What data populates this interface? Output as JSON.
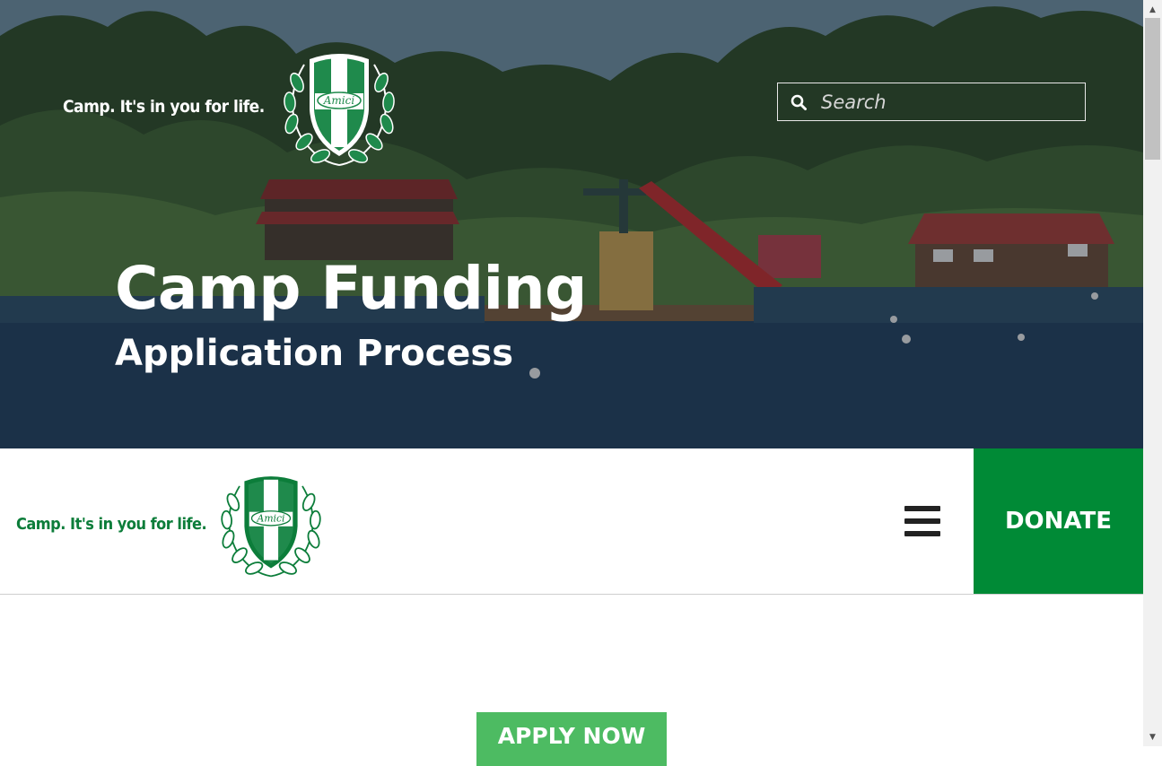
{
  "brand": {
    "tagline": "Camp. It's in you for life.",
    "crest_text": "Amici",
    "color_green": "#008a36",
    "color_green_light": "#4dbb62"
  },
  "hero": {
    "title": "Camp Funding",
    "subtitle": "Application Process"
  },
  "search": {
    "placeholder": "Search",
    "icon": "search-icon"
  },
  "nav": {
    "menu_icon": "hamburger-menu-icon",
    "donate_label": "DONATE"
  },
  "content": {
    "apply_label": "APPLY NOW"
  },
  "scrollbar": {
    "up_arrow": "▲",
    "down_arrow": "▼"
  }
}
